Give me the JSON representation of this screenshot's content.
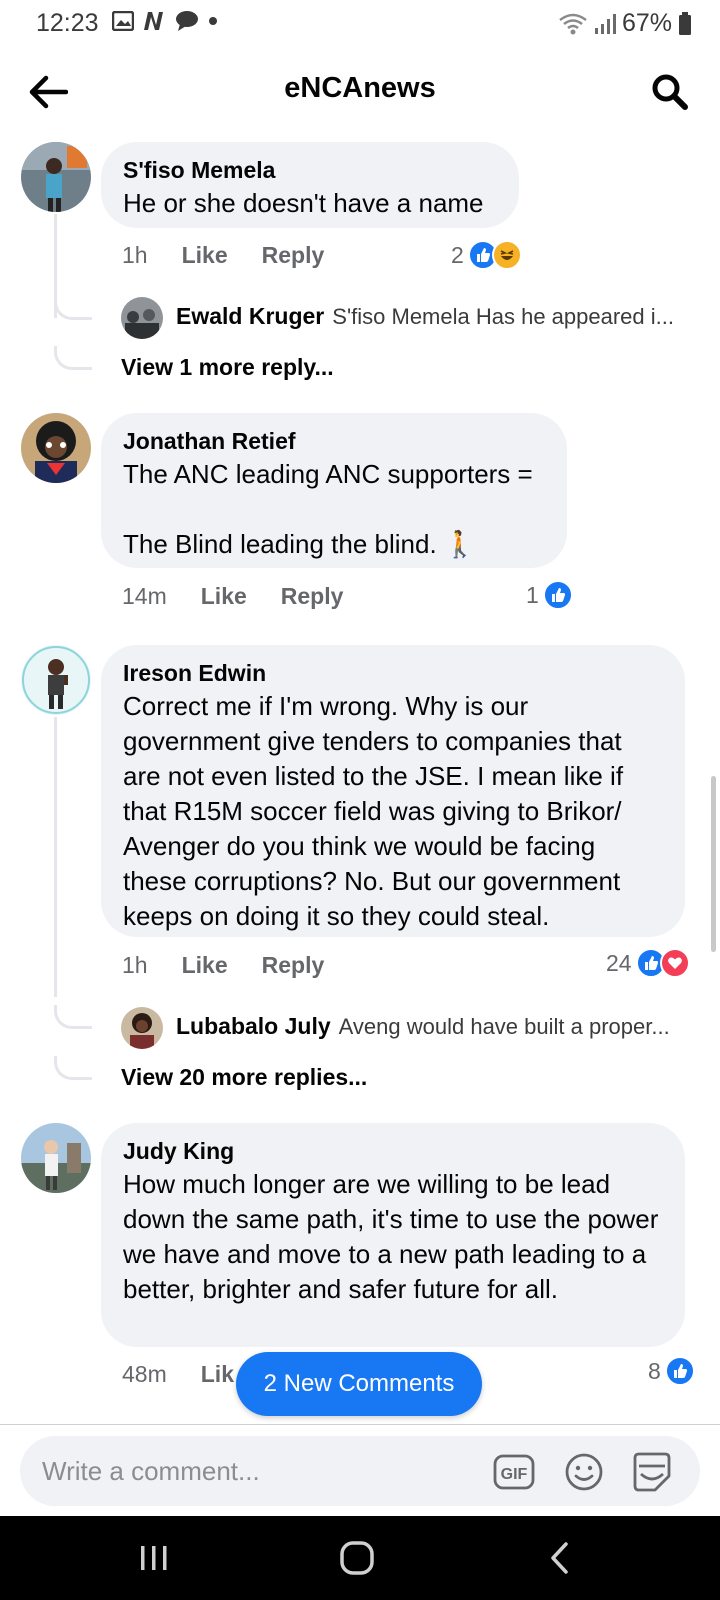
{
  "status_bar": {
    "time": "12:23",
    "battery": "67%"
  },
  "header": {
    "title": "eNCAnews"
  },
  "comments": [
    {
      "name": "S'fiso Memela",
      "text": "He or she doesn't have a name",
      "time": "1h",
      "like": "Like",
      "reply": "Reply",
      "reaction_count": "2",
      "reply_preview": {
        "name": "Ewald Kruger",
        "text": "S'fiso Memela Has he appeared i..."
      },
      "more_replies": "View 1 more reply..."
    },
    {
      "name": "Jonathan Retief",
      "text": "The ANC leading ANC supporters =\n\nThe Blind leading the blind. 🚶",
      "time": "14m",
      "like": "Like",
      "reply": "Reply",
      "reaction_count": "1"
    },
    {
      "name": "Ireson Edwin",
      "text": "Correct me if I'm wrong. Why is our government give tenders to companies that are not even listed to the JSE. I mean like if that R15M soccer field was giving to Brikor/ Avenger do you think we would be facing these corruptions? No. But our government keeps on doing it so they could steal.",
      "time": "1h",
      "like": "Like",
      "reply": "Reply",
      "reaction_count": "24",
      "reply_preview": {
        "name": "Lubabalo July",
        "text": "Aveng would have built a proper..."
      },
      "more_replies": "View 20 more replies..."
    },
    {
      "name": "Judy King",
      "text": "How much longer are we willing to be lead down the same path, it's time to use the power we have and move to a new path leading to a better, brighter and safer future for all.",
      "time": "48m",
      "like": "Lik",
      "reaction_count": "8"
    }
  ],
  "new_comments_pill": "2 New Comments",
  "composer": {
    "placeholder": "Write a comment...",
    "gif_label": "GIF"
  },
  "colors": {
    "accent": "#1877f2",
    "bubble": "#f0f2f5",
    "love": "#f33e58",
    "haha": "#f7b125"
  },
  "icons": [
    "back-arrow-icon",
    "search-icon",
    "like-reaction-icon",
    "haha-reaction-icon",
    "love-reaction-icon",
    "gif-icon",
    "emoji-icon",
    "sticker-icon",
    "recents-icon",
    "home-icon",
    "back-nav-icon"
  ]
}
